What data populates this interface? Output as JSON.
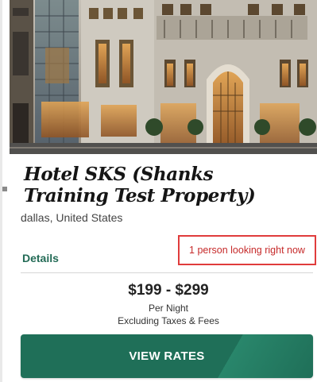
{
  "hotel": {
    "name": "Hotel SKS (Shanks Training Test Property)",
    "location": "dallas, United States"
  },
  "details_label": "Details",
  "looking_text": "1 person looking right now",
  "pricing": {
    "range": "$199 - $299",
    "per_night": "Per Night",
    "excluding": "Excluding Taxes & Fees"
  },
  "button": {
    "label": "VIEW RATES"
  },
  "colors": {
    "accent": "#1f6f58",
    "highlight_box": "#e03c3c"
  }
}
